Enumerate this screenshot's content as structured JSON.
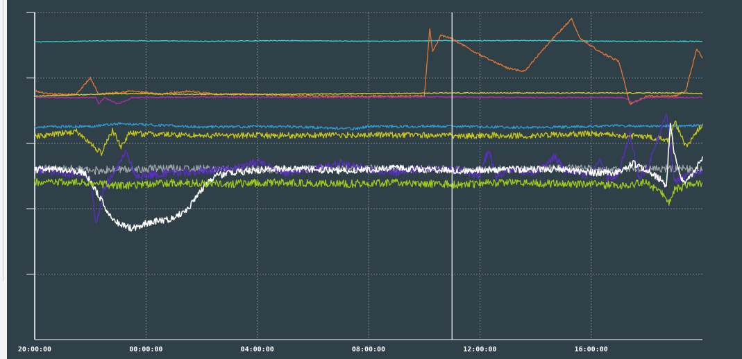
{
  "chart_data": {
    "type": "line",
    "title": "",
    "xlabel": "",
    "ylabel": "",
    "x_unit": "hours since 20:00:00",
    "x_ticks": [
      "20:00:00",
      "00:00:00",
      "04:00:00",
      "08:00:00",
      "12:00:00",
      "16:00:00"
    ],
    "xlim": [
      0,
      24
    ],
    "ylim": [
      0,
      5
    ],
    "y_gridlines": 5,
    "grid": true,
    "cursor_x": 15,
    "colors": {
      "background": "#304049",
      "grid": "#8a979e",
      "axis": "#ffffff",
      "cursor": "#ffffff"
    },
    "series": [
      {
        "color": "#39d2d6",
        "points": [
          [
            0,
            4.55
          ],
          [
            3,
            4.57
          ],
          [
            6,
            4.56
          ],
          [
            9,
            4.57
          ],
          [
            12,
            4.56
          ],
          [
            15,
            4.57
          ],
          [
            18,
            4.57
          ],
          [
            21,
            4.56
          ],
          [
            24,
            4.56
          ]
        ]
      },
      {
        "color": "#e2782f",
        "points": [
          [
            0,
            3.8
          ],
          [
            0.5,
            3.75
          ],
          [
            1.5,
            3.75
          ],
          [
            2,
            4.0
          ],
          [
            2.3,
            3.75
          ],
          [
            3.5,
            3.8
          ],
          [
            4.5,
            3.75
          ],
          [
            5.5,
            3.8
          ],
          [
            6.5,
            3.75
          ],
          [
            8,
            3.75
          ],
          [
            10,
            3.72
          ],
          [
            12,
            3.72
          ],
          [
            14,
            3.72
          ],
          [
            14.2,
            4.75
          ],
          [
            14.3,
            4.4
          ],
          [
            14.6,
            4.65
          ],
          [
            15,
            4.6
          ],
          [
            16,
            4.35
          ],
          [
            17,
            4.15
          ],
          [
            17.6,
            4.1
          ],
          [
            18.5,
            4.55
          ],
          [
            19.3,
            4.9
          ],
          [
            19.6,
            4.6
          ],
          [
            20.4,
            4.38
          ],
          [
            21,
            4.25
          ],
          [
            21.4,
            3.6
          ],
          [
            22,
            3.72
          ],
          [
            23,
            3.72
          ],
          [
            23.4,
            3.8
          ],
          [
            23.8,
            4.45
          ],
          [
            24,
            4.3
          ]
        ]
      },
      {
        "color": "#d0d12e",
        "points": [
          [
            0,
            3.72
          ],
          [
            3,
            3.76
          ],
          [
            6,
            3.75
          ],
          [
            9,
            3.75
          ],
          [
            12,
            3.76
          ],
          [
            15,
            3.77
          ],
          [
            18,
            3.77
          ],
          [
            21,
            3.77
          ],
          [
            23,
            3.77
          ],
          [
            24,
            3.76
          ]
        ]
      },
      {
        "color": "#b02da8",
        "points": [
          [
            0,
            3.7
          ],
          [
            2.2,
            3.7
          ],
          [
            2.3,
            3.6
          ],
          [
            2.5,
            3.7
          ],
          [
            3,
            3.6
          ],
          [
            3.5,
            3.7
          ],
          [
            6,
            3.71
          ],
          [
            10,
            3.7
          ],
          [
            14,
            3.71
          ],
          [
            18,
            3.7
          ],
          [
            21.2,
            3.7
          ],
          [
            21.5,
            3.62
          ],
          [
            22,
            3.7
          ],
          [
            24,
            3.7
          ]
        ]
      },
      {
        "color": "#2c9fd8",
        "points": [
          [
            0,
            3.25
          ],
          [
            2,
            3.26
          ],
          [
            3,
            3.3
          ],
          [
            6,
            3.25
          ],
          [
            9,
            3.26
          ],
          [
            11.5,
            3.22
          ],
          [
            12,
            3.26
          ],
          [
            15,
            3.26
          ],
          [
            18,
            3.24
          ],
          [
            21,
            3.27
          ],
          [
            22,
            3.26
          ],
          [
            23,
            3.27
          ],
          [
            24,
            3.27
          ]
        ]
      },
      {
        "color": "#c7c61c",
        "points": [
          [
            0,
            3.1
          ],
          [
            1.5,
            3.18
          ],
          [
            2.4,
            2.85
          ],
          [
            2.8,
            3.2
          ],
          [
            3.1,
            2.95
          ],
          [
            3.4,
            3.15
          ],
          [
            6,
            3.12
          ],
          [
            9,
            3.12
          ],
          [
            12,
            3.13
          ],
          [
            15,
            3.12
          ],
          [
            18,
            3.12
          ],
          [
            20,
            3.15
          ],
          [
            21,
            3.12
          ],
          [
            22,
            3.1
          ],
          [
            22.8,
            3.05
          ],
          [
            23,
            3.35
          ],
          [
            23.4,
            2.95
          ],
          [
            24,
            3.3
          ]
        ]
      },
      {
        "color": "#9ea3a8",
        "points": [
          [
            0,
            2.6
          ],
          [
            1,
            2.62
          ],
          [
            2,
            2.58
          ],
          [
            3,
            2.6
          ],
          [
            5,
            2.62
          ],
          [
            7,
            2.6
          ],
          [
            9,
            2.6
          ],
          [
            11,
            2.62
          ],
          [
            13,
            2.61
          ],
          [
            15,
            2.6
          ],
          [
            17,
            2.6
          ],
          [
            19,
            2.62
          ],
          [
            21,
            2.6
          ],
          [
            23,
            2.62
          ],
          [
            24,
            2.6
          ]
        ]
      },
      {
        "color": "#5b2ec4",
        "points": [
          [
            0,
            2.6
          ],
          [
            1,
            2.55
          ],
          [
            2,
            2.5
          ],
          [
            2.2,
            1.75
          ],
          [
            2.5,
            2.3
          ],
          [
            3,
            2.65
          ],
          [
            3.3,
            2.9
          ],
          [
            3.6,
            2.5
          ],
          [
            5,
            2.55
          ],
          [
            7,
            2.6
          ],
          [
            8,
            2.72
          ],
          [
            9,
            2.55
          ],
          [
            10,
            2.6
          ],
          [
            11,
            2.7
          ],
          [
            12,
            2.6
          ],
          [
            13,
            2.55
          ],
          [
            14,
            2.62
          ],
          [
            15,
            2.6
          ],
          [
            16,
            2.52
          ],
          [
            16.3,
            2.9
          ],
          [
            16.6,
            2.5
          ],
          [
            17,
            2.6
          ],
          [
            18,
            2.55
          ],
          [
            18.7,
            2.8
          ],
          [
            19,
            2.6
          ],
          [
            20,
            2.5
          ],
          [
            20.3,
            2.75
          ],
          [
            20.6,
            2.45
          ],
          [
            21,
            2.55
          ],
          [
            21.4,
            3.15
          ],
          [
            21.7,
            2.5
          ],
          [
            22,
            2.6
          ],
          [
            22.7,
            3.45
          ],
          [
            23,
            2.4
          ],
          [
            23.3,
            2.5
          ],
          [
            24,
            2.55
          ]
        ]
      },
      {
        "color": "#ffffff",
        "points": [
          [
            0,
            2.6
          ],
          [
            1,
            2.6
          ],
          [
            1.8,
            2.55
          ],
          [
            2.3,
            2.2
          ],
          [
            2.7,
            1.9
          ],
          [
            3,
            1.78
          ],
          [
            3.5,
            1.7
          ],
          [
            4,
            1.78
          ],
          [
            4.5,
            1.82
          ],
          [
            5,
            1.85
          ],
          [
            5.5,
            2.0
          ],
          [
            6,
            2.3
          ],
          [
            6.5,
            2.5
          ],
          [
            7,
            2.55
          ],
          [
            9,
            2.62
          ],
          [
            11,
            2.58
          ],
          [
            13,
            2.62
          ],
          [
            15,
            2.58
          ],
          [
            17,
            2.6
          ],
          [
            19,
            2.6
          ],
          [
            20,
            2.55
          ],
          [
            21,
            2.55
          ],
          [
            21.5,
            2.7
          ],
          [
            22,
            2.58
          ],
          [
            22.5,
            2.45
          ],
          [
            22.7,
            2.3
          ],
          [
            22.85,
            3.35
          ],
          [
            23,
            2.8
          ],
          [
            23.3,
            2.4
          ],
          [
            23.7,
            2.55
          ],
          [
            24,
            2.8
          ]
        ]
      },
      {
        "color": "#9dc71b",
        "points": [
          [
            0,
            2.4
          ],
          [
            2,
            2.4
          ],
          [
            3,
            2.35
          ],
          [
            5,
            2.4
          ],
          [
            7,
            2.38
          ],
          [
            9,
            2.4
          ],
          [
            11,
            2.38
          ],
          [
            13,
            2.4
          ],
          [
            15,
            2.37
          ],
          [
            17,
            2.4
          ],
          [
            19,
            2.38
          ],
          [
            21,
            2.36
          ],
          [
            22,
            2.4
          ],
          [
            22.6,
            2.22
          ],
          [
            22.8,
            2.1
          ],
          [
            23,
            2.3
          ],
          [
            24,
            2.4
          ]
        ]
      }
    ]
  }
}
